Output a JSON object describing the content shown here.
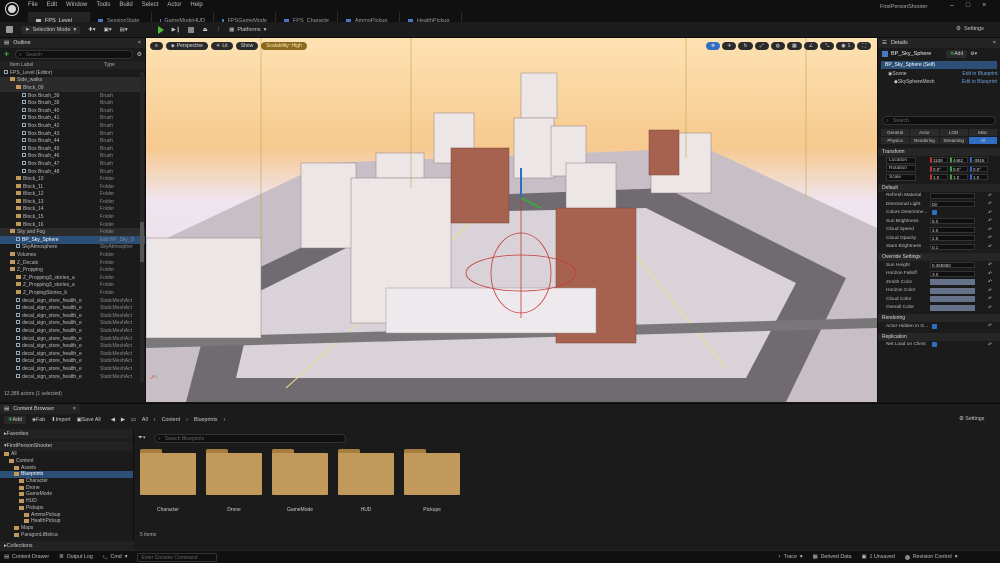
{
  "titlebar": {
    "app_title": "FirstPersonShooter",
    "menus": [
      "File",
      "Edit",
      "Window",
      "Tools",
      "Build",
      "Select",
      "Actor",
      "Help"
    ],
    "tabs": [
      "FPS_Level",
      "SessionState",
      "GameModeHUD",
      "FPSGameMode",
      "FPS_Characte",
      "AmmoPickup",
      "HealthPickup"
    ]
  },
  "toolbar": {
    "save": "",
    "mode": "Selection Mode",
    "platforms": "Platforms",
    "settings": "Settings"
  },
  "outliner": {
    "title": "Outline",
    "search_placeholder": "Search",
    "col_label": "Item Label",
    "col_type": "Type",
    "status": "12,389 actors (1 selected)",
    "rows": [
      {
        "n": "FPS_Level (Editor)",
        "t": "",
        "k": "lvl",
        "d": 0
      },
      {
        "n": "Side_walks",
        "t": "",
        "k": "f",
        "d": 1,
        "hl": true
      },
      {
        "n": "Block_09",
        "t": "",
        "k": "f",
        "d": 2,
        "hl": true
      },
      {
        "n": "Box Brush_39",
        "t": "Brush",
        "k": "b",
        "d": 3
      },
      {
        "n": "Box Brush_39",
        "t": "Brush",
        "k": "b",
        "d": 3
      },
      {
        "n": "Box Brush_40",
        "t": "Brush",
        "k": "b",
        "d": 3
      },
      {
        "n": "Box Brush_41",
        "t": "Brush",
        "k": "b",
        "d": 3
      },
      {
        "n": "Box Brush_42",
        "t": "Brush",
        "k": "b",
        "d": 3
      },
      {
        "n": "Box Brush_43",
        "t": "Brush",
        "k": "b",
        "d": 3
      },
      {
        "n": "Box Brush_44",
        "t": "Brush",
        "k": "b",
        "d": 3
      },
      {
        "n": "Box Brush_45",
        "t": "Brush",
        "k": "b",
        "d": 3
      },
      {
        "n": "Box Brush_46",
        "t": "Brush",
        "k": "b",
        "d": 3
      },
      {
        "n": "Box Brush_47",
        "t": "Brush",
        "k": "b",
        "d": 3
      },
      {
        "n": "Box Brush_48",
        "t": "Brush",
        "k": "b",
        "d": 3
      },
      {
        "n": "Block_10",
        "t": "Folder",
        "k": "f",
        "d": 2
      },
      {
        "n": "Block_11",
        "t": "Folder",
        "k": "f",
        "d": 2
      },
      {
        "n": "Block_12",
        "t": "Folder",
        "k": "f",
        "d": 2
      },
      {
        "n": "Block_13",
        "t": "Folder",
        "k": "f",
        "d": 2
      },
      {
        "n": "Block_14",
        "t": "Folder",
        "k": "f",
        "d": 2
      },
      {
        "n": "Block_15",
        "t": "Folder",
        "k": "f",
        "d": 2
      },
      {
        "n": "Block_16",
        "t": "Folder",
        "k": "f",
        "d": 2
      },
      {
        "n": "Sky and Fog",
        "t": "Folder",
        "k": "f",
        "d": 1,
        "hl": true
      },
      {
        "n": "BP_Sky_Sphere",
        "t": "Edit BP_Sky_S",
        "k": "b",
        "d": 2,
        "sel": true
      },
      {
        "n": "SkyAtmosphere",
        "t": "SkyAtmospher",
        "k": "b",
        "d": 2
      },
      {
        "n": "Volumes",
        "t": "Folder",
        "k": "f",
        "d": 1
      },
      {
        "n": "Z_Decals",
        "t": "Folder",
        "k": "f",
        "d": 1
      },
      {
        "n": "Z_Propping",
        "t": "Folder",
        "k": "f",
        "d": 1
      },
      {
        "n": "Z_Propping3_stories_a",
        "t": "Folder",
        "k": "f",
        "d": 2
      },
      {
        "n": "Z_Propping3_stories_a",
        "t": "Folder",
        "k": "f",
        "d": 2
      },
      {
        "n": "Z_PropingStories_b",
        "t": "Folder",
        "k": "f",
        "d": 2
      },
      {
        "n": "decal_sign_store_health_e",
        "t": "StaticMeshAct",
        "k": "b",
        "d": 2
      },
      {
        "n": "decal_sign_store_health_e",
        "t": "StaticMeshAct",
        "k": "b",
        "d": 2
      },
      {
        "n": "decal_sign_store_health_e",
        "t": "StaticMeshAct",
        "k": "b",
        "d": 2
      },
      {
        "n": "decal_sign_store_health_e",
        "t": "StaticMeshAct",
        "k": "b",
        "d": 2
      },
      {
        "n": "decal_sign_store_health_e",
        "t": "StaticMeshAct",
        "k": "b",
        "d": 2
      },
      {
        "n": "decal_sign_store_health_e",
        "t": "StaticMeshAct",
        "k": "b",
        "d": 2
      },
      {
        "n": "decal_sign_store_health_e",
        "t": "StaticMeshAct",
        "k": "b",
        "d": 2
      },
      {
        "n": "decal_sign_store_health_e",
        "t": "StaticMeshAct",
        "k": "b",
        "d": 2
      },
      {
        "n": "decal_sign_store_health_e",
        "t": "StaticMeshAct",
        "k": "b",
        "d": 2
      },
      {
        "n": "decal_sign_store_health_e",
        "t": "StaticMeshAct",
        "k": "b",
        "d": 2
      },
      {
        "n": "decal_sign_store_health_e",
        "t": "StaticMeshAct",
        "k": "b",
        "d": 2
      }
    ]
  },
  "viewport": {
    "perspective": "Perspective",
    "lit": "Lit",
    "show": "Show",
    "scalability": "Scalability: High",
    "camera_speed": "1"
  },
  "details": {
    "title": "Details",
    "actor": "BP_Sky_Sphere",
    "add": "Add",
    "self": "BP_Sky_Sphere (Self)",
    "scene": "Scene",
    "scene_link": "Edit in Blueprint",
    "mesh": "SkySphereMesh",
    "mesh_link": "Edit in Blueprint",
    "search_placeholder": "Search",
    "filters": [
      "General",
      "Actor",
      "LOD",
      "Misc",
      "Physics",
      "Rendering",
      "Streaming",
      "All"
    ],
    "transform_section": "Transform",
    "transform": [
      {
        "label": "Location",
        "v": [
          "1108",
          "4462",
          "-3918"
        ]
      },
      {
        "label": "Rotation",
        "v": [
          "0.0°",
          "0.0°",
          "0.0°"
        ]
      },
      {
        "label": "Scale",
        "v": [
          "1.0",
          "1.0",
          "1.0"
        ]
      }
    ],
    "default_section": "Default",
    "default": [
      {
        "label": "Refresh Material",
        "type": "text",
        "v": ""
      },
      {
        "label": "Directional Light",
        "type": "text",
        "v": "Dir"
      },
      {
        "label": "Colors Determine...",
        "type": "check",
        "v": ""
      },
      {
        "label": "Sun Brightness",
        "type": "text",
        "v": "8.0"
      },
      {
        "label": "Cloud Speed",
        "type": "text",
        "v": "4.0"
      },
      {
        "label": "Cloud Opacity",
        "type": "text",
        "v": "2.5"
      },
      {
        "label": "Stars Brightness",
        "type": "text",
        "v": "0.1"
      }
    ],
    "override_section": "Override Settings",
    "override": [
      {
        "label": "Sun Height",
        "type": "text",
        "v": "0.365960"
      },
      {
        "label": "Horizon Falloff",
        "type": "text",
        "v": "3.0"
      },
      {
        "label": "Zenith Color",
        "type": "color",
        "v": ""
      },
      {
        "label": "Horizon Color",
        "type": "color",
        "v": ""
      },
      {
        "label": "Cloud Color",
        "type": "color",
        "v": ""
      },
      {
        "label": "Overall Color",
        "type": "color",
        "v": ""
      }
    ],
    "rendering_section": "Rendering",
    "rendering": [
      {
        "label": "Actor Hidden In G...",
        "type": "check",
        "v": ""
      }
    ],
    "replication_section": "Replication",
    "replication": [
      {
        "label": "Net Load on Client",
        "type": "check",
        "v": ""
      }
    ]
  },
  "content_browser": {
    "title": "Content Browser",
    "add": "Add",
    "import": "Import",
    "fab": "Fab",
    "save_all": "Save All",
    "path": [
      "All",
      "Content",
      "Blueprints"
    ],
    "settings": "Settings",
    "search_placeholder": "Search Blueprints",
    "favorites": "Favorites",
    "project": "FirstPersonShooter",
    "collections": "Collections",
    "item_count": "5 items",
    "tree": [
      {
        "n": "All",
        "d": 0
      },
      {
        "n": "Content",
        "d": 1
      },
      {
        "n": "Assets",
        "d": 2
      },
      {
        "n": "Blueprints",
        "d": 2,
        "sel": true
      },
      {
        "n": "Character",
        "d": 3
      },
      {
        "n": "Drone",
        "d": 3
      },
      {
        "n": "GameMode",
        "d": 3
      },
      {
        "n": "HUD",
        "d": 3
      },
      {
        "n": "Pickups",
        "d": 3
      },
      {
        "n": "AmmoPickup",
        "d": 4
      },
      {
        "n": "HealthPickup",
        "d": 4
      },
      {
        "n": "Maps",
        "d": 2
      },
      {
        "n": "ParagonLtBelica",
        "d": 2
      }
    ],
    "folders": [
      "Character",
      "Drone",
      "GameMode",
      "HUD",
      "Pickups"
    ]
  },
  "statusbar": {
    "content_drawer": "Content Drawer",
    "output_log": "Output Log",
    "cmd": "Cmd",
    "cmd_placeholder": "Enter Console Command",
    "trace": "Trace",
    "derived": "Derived Data",
    "unsaved": "1 Unsaved",
    "revision": "Revision Control"
  }
}
